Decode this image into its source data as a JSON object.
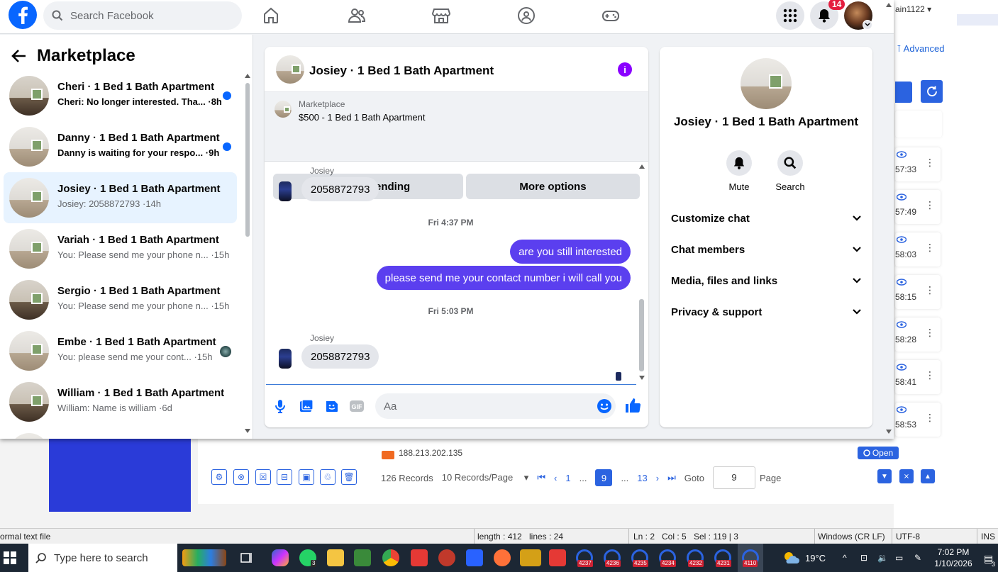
{
  "facebook": {
    "search_placeholder": "Search Facebook",
    "notifications_count": "14",
    "left_panel": {
      "title": "Marketplace",
      "conversations": [
        {
          "name": "Cheri · 1 Bed 1 Bath Apartment",
          "preview": "Cheri: No longer interested. Tha... ·8h",
          "unread": true
        },
        {
          "name": "Danny · 1 Bed 1 Bath Apartment",
          "preview": "Danny is waiting for your respo... ·9h",
          "unread": true
        },
        {
          "name": "Josiey · 1 Bed 1 Bath Apartment",
          "preview": "Josiey: 2058872793 ·14h",
          "selected": true
        },
        {
          "name": "Variah · 1 Bed 1 Bath Apartment",
          "preview": "You: Please send me your phone n... ·15h"
        },
        {
          "name": "Sergio · 1 Bed 1 Bath Apartment",
          "preview": "You: Please send me your phone n... ·15h"
        },
        {
          "name": "Embe · 1 Bed 1 Bath Apartment",
          "preview": "You: please send me your cont... ·15h",
          "seen": true
        },
        {
          "name": "William · 1 Bed 1 Bath Apartment",
          "preview": "William: Name is william ·6d"
        }
      ]
    },
    "chat": {
      "title": "Josiey · 1 Bed 1 Bath Apartment",
      "marketplace_label": "Marketplace",
      "listing": "$500 - 1 Bed 1 Bath Apartment",
      "mark_pending_label": "Mark as pending",
      "more_options_label": "More options",
      "messages": {
        "sender1": "Josiey",
        "msg1": "2058872793",
        "time1": "Fri 4:37 PM",
        "out1": "are you still interested",
        "out2": "please send me your contact number i will call you",
        "time2": "Fri 5:03 PM",
        "sender2": "Josiey",
        "msg2": "2058872793"
      },
      "compose_placeholder": "Aa"
    },
    "info_panel": {
      "name": "Josiey · 1 Bed 1 Bath Apartment",
      "mute_label": "Mute",
      "search_label": "Search",
      "sections": [
        "Customize chat",
        "Chat members",
        "Media, files and links",
        "Privacy & support"
      ]
    }
  },
  "background_app": {
    "username": "ain1122",
    "advanced_label": "Advanced",
    "times": [
      "57:33",
      "57:49",
      "58:03",
      "58:15",
      "58:28",
      "58:41",
      "58:53"
    ],
    "ip": "188.213.202.135",
    "open_label": "Open",
    "records": "126 Records",
    "per_page": "10 Records/Page",
    "page_first": "1",
    "ellipsis": "...",
    "page_current": "9",
    "page_last": "13",
    "goto_label": "Goto",
    "goto_value": "9",
    "page_label": "Page"
  },
  "status_bar": {
    "file_type": "ormal text file",
    "length": "length : 412",
    "lines": "lines : 24",
    "ln": "Ln : 2",
    "col": "Col : 5",
    "sel": "Sel : 119 | 3",
    "eol": "Windows (CR LF)",
    "encoding": "UTF-8",
    "mode": "INS"
  },
  "taskbar": {
    "search_placeholder": "Type here to search",
    "whatsapp_badge": "3",
    "badges": [
      "4237",
      "4236",
      "4235",
      "4234",
      "4232",
      "4231",
      "4110"
    ],
    "temperature": "19°C",
    "time": "7:02 PM",
    "date": "1/10/2026",
    "notif_badge": "3"
  }
}
